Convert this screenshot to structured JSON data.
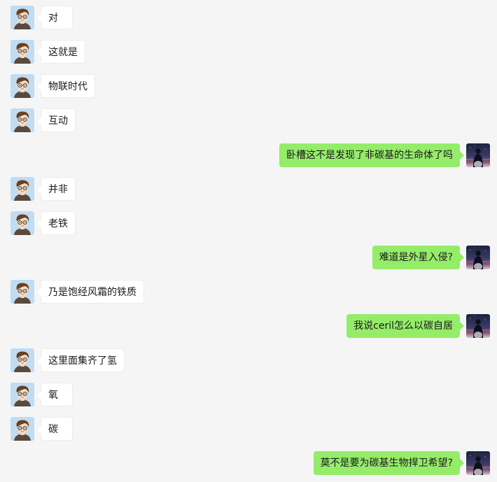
{
  "chat": {
    "messages": [
      {
        "sender": "other",
        "text": "对"
      },
      {
        "sender": "other",
        "text": "这就是"
      },
      {
        "sender": "other",
        "text": "物联时代"
      },
      {
        "sender": "other",
        "text": "互动"
      },
      {
        "sender": "self",
        "text": "卧槽这不是发现了非碳基的生命体了吗"
      },
      {
        "sender": "other",
        "text": "并非"
      },
      {
        "sender": "other",
        "text": "老铁"
      },
      {
        "sender": "self",
        "text": "难道是外星入侵?"
      },
      {
        "sender": "other",
        "text": "乃是饱经风霜的铁质"
      },
      {
        "sender": "self",
        "text": "我说ceril怎么以碳自居"
      },
      {
        "sender": "other",
        "text": "这里面集齐了氢"
      },
      {
        "sender": "other",
        "text": "氧"
      },
      {
        "sender": "other",
        "text": "碳"
      },
      {
        "sender": "self",
        "text": "莫不是要为碳基生物捍卫希望?"
      }
    ]
  },
  "colors": {
    "background": "#f5f5f5",
    "self_bubble": "#95ec69",
    "other_bubble": "#ffffff"
  },
  "icons": {
    "other_avatar": "cartoon-boy-glasses-avatar",
    "self_avatar": "night-sky-silhouette-avatar"
  }
}
